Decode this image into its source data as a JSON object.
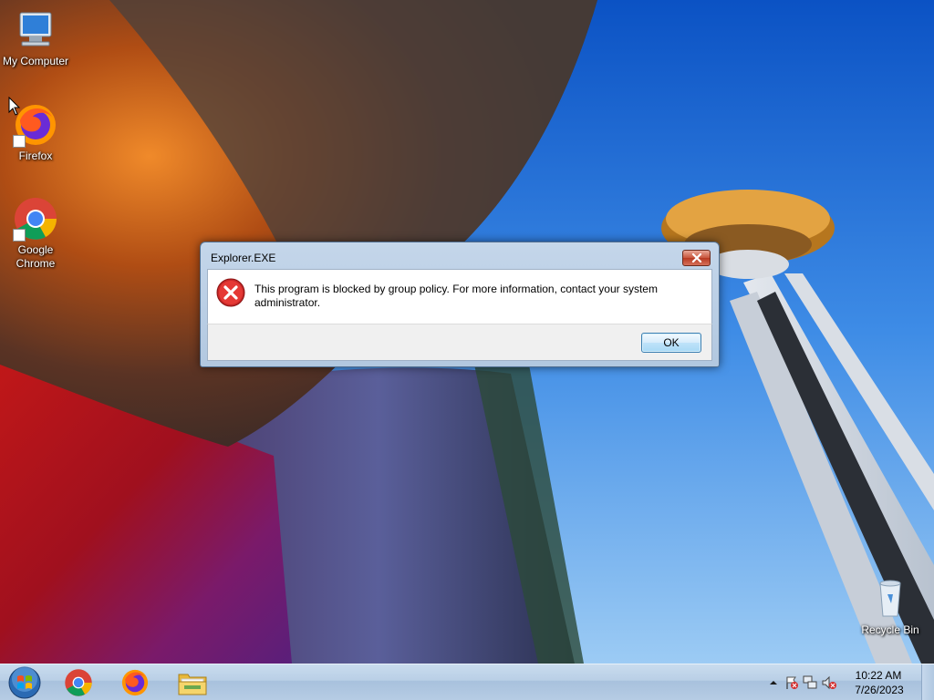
{
  "desktop": {
    "icons": [
      {
        "label": "My Computer",
        "icon": "computer-icon"
      },
      {
        "label": "Firefox",
        "icon": "firefox-icon"
      },
      {
        "label": "Google Chrome",
        "icon": "chrome-icon"
      },
      {
        "label": "Recycle Bin",
        "icon": "recycle-bin-icon"
      }
    ]
  },
  "dialog": {
    "title": "Explorer.EXE",
    "message": "This program is blocked by group policy. For more information, contact your system administrator.",
    "ok_label": "OK",
    "icon": "error-icon"
  },
  "taskbar": {
    "pinned": [
      {
        "name": "chrome",
        "icon": "chrome-icon"
      },
      {
        "name": "firefox",
        "icon": "firefox-icon"
      },
      {
        "name": "explorer",
        "icon": "folder-icon"
      }
    ],
    "tray_icons": [
      "show-hidden-icons",
      "action-center-flag-icon",
      "network-icon",
      "volume-muted-icon"
    ],
    "clock": {
      "time": "10:22 AM",
      "date": "7/26/2023"
    }
  }
}
